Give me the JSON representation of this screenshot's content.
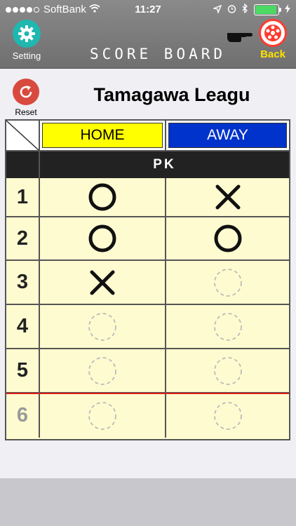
{
  "status": {
    "carrier": "SoftBank",
    "time": "11:27"
  },
  "nav": {
    "setting_label": "Setting",
    "title": "SCORE BOARD",
    "back_label": "Back"
  },
  "reset_label": "Reset",
  "league_name": "Tamagawa Leagu",
  "table": {
    "home_label": "HOME",
    "away_label": "AWAY",
    "section_label": "PK",
    "rows": [
      {
        "number": "1",
        "home": "scored",
        "away": "missed"
      },
      {
        "number": "2",
        "home": "scored",
        "away": "scored"
      },
      {
        "number": "3",
        "home": "missed",
        "away": "empty"
      },
      {
        "number": "4",
        "home": "empty",
        "away": "empty"
      },
      {
        "number": "5",
        "home": "empty",
        "away": "empty"
      },
      {
        "number": "6",
        "home": "empty",
        "away": "empty"
      }
    ]
  },
  "colors": {
    "home": "#ffff00",
    "away": "#0033cc",
    "setting": "#1fb7b0",
    "back_label": "#ffe100",
    "divider": "#e0201c"
  }
}
